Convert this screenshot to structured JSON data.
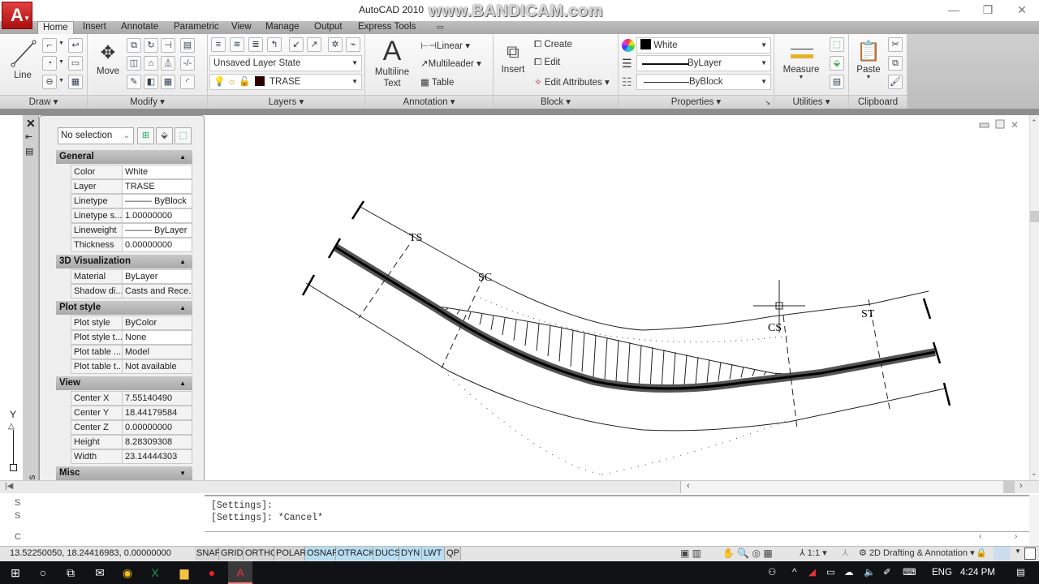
{
  "app": {
    "title": "AutoCAD 2010",
    "watermark": "www.BANDICAM.com",
    "menu_logo": "A"
  },
  "window_controls": {
    "minimize": "—",
    "restore": "❐",
    "close": "✕"
  },
  "tabs": [
    {
      "label": "Home",
      "active": true
    },
    {
      "label": "Insert"
    },
    {
      "label": "Annotate"
    },
    {
      "label": "Parametric"
    },
    {
      "label": "View"
    },
    {
      "label": "Manage"
    },
    {
      "label": "Output"
    },
    {
      "label": "Express Tools"
    }
  ],
  "ribbon": {
    "draw": {
      "title": "Draw",
      "line_label": "Line"
    },
    "modify": {
      "title": "Modify",
      "move_label": "Move"
    },
    "layers": {
      "title": "Layers",
      "layer_state": "Unsaved Layer State",
      "current_layer": "TRASE",
      "layer_color": "#2a0000"
    },
    "annotation": {
      "title": "Annotation",
      "mtext_label1": "Multiline",
      "mtext_label2": "Text",
      "linear": "Linear",
      "multileader": "Multileader",
      "table": "Table"
    },
    "block": {
      "title": "Block",
      "insert": "Insert",
      "create": "Create",
      "edit": "Edit",
      "edit_attributes": "Edit Attributes"
    },
    "properties": {
      "title": "Properties",
      "color": "White",
      "linetype": "ByLayer",
      "lineweight": "ByBlock"
    },
    "utilities": {
      "title": "Utilities",
      "measure": "Measure"
    },
    "clipboard": {
      "title": "Clipboard",
      "paste": "Paste"
    }
  },
  "properties_palette": {
    "selection": "No selection",
    "side_label": "Properties",
    "sections": [
      {
        "title": "General",
        "rows": [
          {
            "key": "Color",
            "value": "White"
          },
          {
            "key": "Layer",
            "value": "TRASE"
          },
          {
            "key": "Linetype",
            "value": "——— ByBlock"
          },
          {
            "key": "Linetype s...",
            "value": "1.00000000"
          },
          {
            "key": "Lineweight",
            "value": "——— ByLayer"
          },
          {
            "key": "Thickness",
            "value": "0.00000000"
          }
        ]
      },
      {
        "title": "3D Visualization",
        "rows": [
          {
            "key": "Material",
            "value": "ByLayer"
          },
          {
            "key": "Shadow di...",
            "value": "Casts and Rece..."
          }
        ]
      },
      {
        "title": "Plot style",
        "rows": [
          {
            "key": "Plot style",
            "value": "ByColor"
          },
          {
            "key": "Plot style t...",
            "value": "None"
          },
          {
            "key": "Plot table ...",
            "value": "Model"
          },
          {
            "key": "Plot table t...",
            "value": "Not available"
          }
        ]
      },
      {
        "title": "View",
        "rows": [
          {
            "key": "Center X",
            "value": "7.55140490"
          },
          {
            "key": "Center Y",
            "value": "18.44179584"
          },
          {
            "key": "Center Z",
            "value": "0.00000000"
          },
          {
            "key": "Height",
            "value": "8.28309308"
          },
          {
            "key": "Width",
            "value": "23.14444303"
          }
        ]
      },
      {
        "title": "Misc",
        "rows": []
      }
    ]
  },
  "drawing": {
    "labels": {
      "ts": "TS",
      "sc": "SC",
      "cs": "CS",
      "st": "ST"
    },
    "ucs_y": "Y"
  },
  "command": {
    "lines": [
      "[Settings]:",
      "[Settings]: *Cancel*"
    ],
    "input": ""
  },
  "status": {
    "coords": "13.52250050, 18.24416983, 0.00000000",
    "toggles": [
      {
        "label": "SNAP",
        "on": false
      },
      {
        "label": "GRID",
        "on": false
      },
      {
        "label": "ORTHO",
        "on": false
      },
      {
        "label": "POLAR",
        "on": false
      },
      {
        "label": "OSNAP",
        "on": true
      },
      {
        "label": "OTRACK",
        "on": true
      },
      {
        "label": "DUCS",
        "on": true
      },
      {
        "label": "DYN",
        "on": true
      },
      {
        "label": "LWT",
        "on": true
      },
      {
        "label": "QP",
        "on": false
      }
    ],
    "annotation_scale": "1:1",
    "workspace": "2D Drafting & Annotation"
  },
  "taskbar": {
    "language": "ENG",
    "time": "4:24 PM"
  }
}
